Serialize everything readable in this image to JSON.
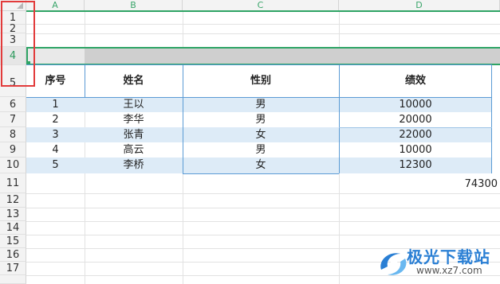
{
  "columns": [
    "A",
    "B",
    "C",
    "D"
  ],
  "rows": [
    "1",
    "2",
    "3",
    "4",
    "5",
    "6",
    "7",
    "8",
    "9",
    "10",
    "11",
    "12",
    "13",
    "14",
    "15",
    "16",
    "17"
  ],
  "selected_row": "4",
  "table": {
    "headers": [
      "序号",
      "姓名",
      "性别",
      "绩效"
    ],
    "records": [
      [
        "1",
        "王以",
        "男",
        "10000"
      ],
      [
        "2",
        "李华",
        "男",
        "20000"
      ],
      [
        "3",
        "张青",
        "女",
        "22000"
      ],
      [
        "4",
        "高云",
        "男",
        "10000"
      ],
      [
        "5",
        "李桥",
        "女",
        "12300"
      ]
    ],
    "total": "74300"
  },
  "watermark": {
    "name": "极光下载站",
    "url": "www.xz7.com"
  },
  "colors": {
    "accent_green": "#2ea465",
    "band_blue": "#ddebf7",
    "border_blue": "#5b9bd5",
    "highlight_red": "#e23b3b"
  }
}
